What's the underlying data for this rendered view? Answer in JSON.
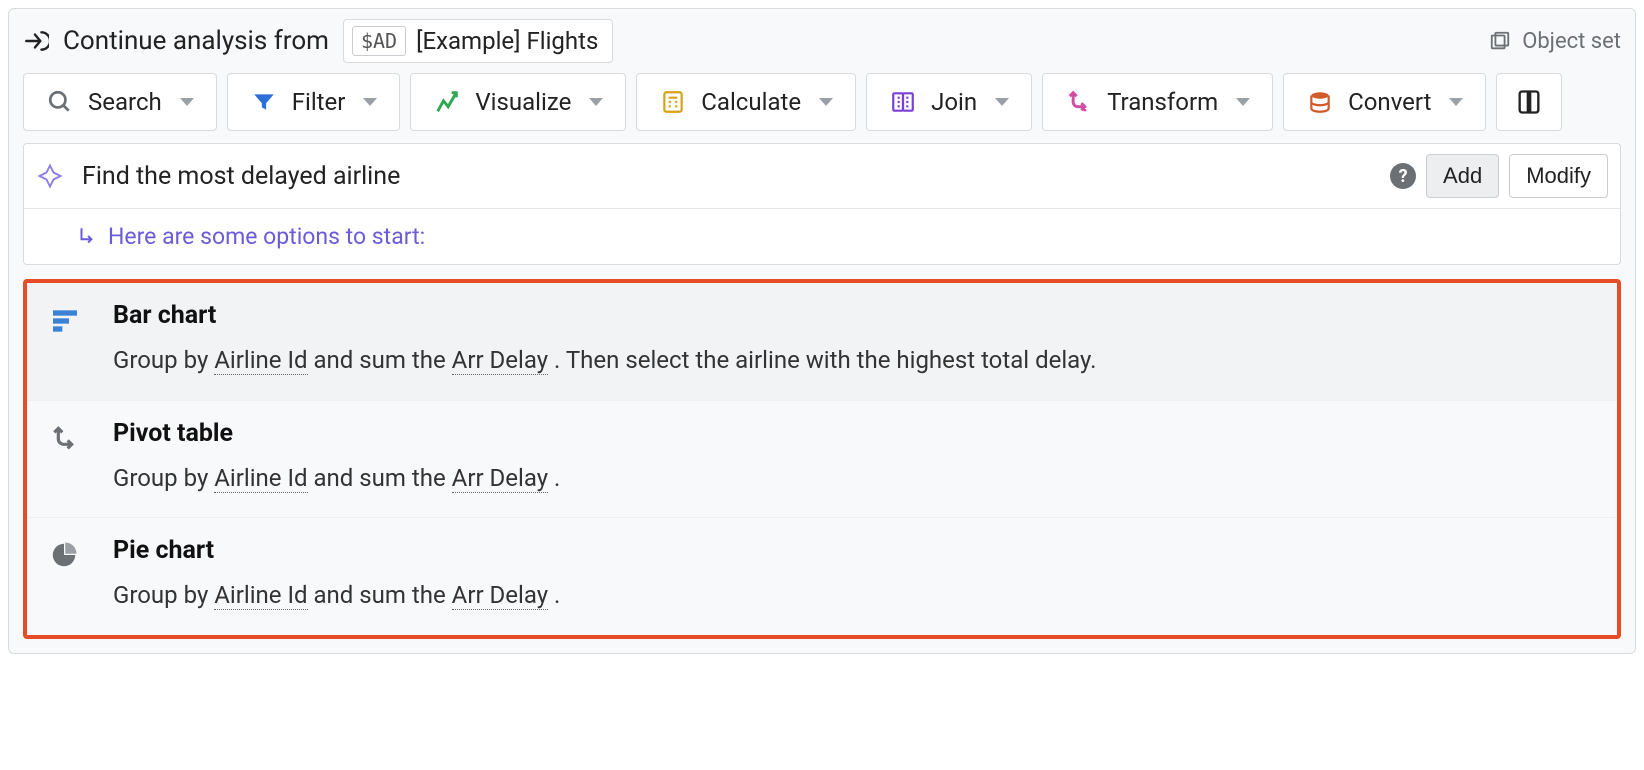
{
  "header": {
    "prefix": "Continue analysis from",
    "badge": "$AD",
    "chip_label": "[Example] Flights",
    "object_set_label": "Object set"
  },
  "toolbar": {
    "search": "Search",
    "filter": "Filter",
    "visualize": "Visualize",
    "calculate": "Calculate",
    "join": "Join",
    "transform": "Transform",
    "convert": "Convert"
  },
  "search": {
    "value": "Find the most delayed airline",
    "help_tooltip": "?",
    "add_label": "Add",
    "modify_label": "Modify",
    "hint": "Here are some options to start:"
  },
  "suggestions": [
    {
      "title": "Bar chart",
      "desc_pre": "Group by ",
      "term1": "Airline Id",
      "desc_mid": " and sum the ",
      "term2": "Arr Delay",
      "desc_post": " . Then select the airline with the highest total delay."
    },
    {
      "title": "Pivot table",
      "desc_pre": "Group by ",
      "term1": "Airline Id",
      "desc_mid": " and sum the ",
      "term2": "Arr Delay",
      "desc_post": " ."
    },
    {
      "title": "Pie chart",
      "desc_pre": "Group by ",
      "term1": "Airline Id",
      "desc_mid": " and sum the ",
      "term2": "Arr Delay",
      "desc_post": " ."
    }
  ]
}
